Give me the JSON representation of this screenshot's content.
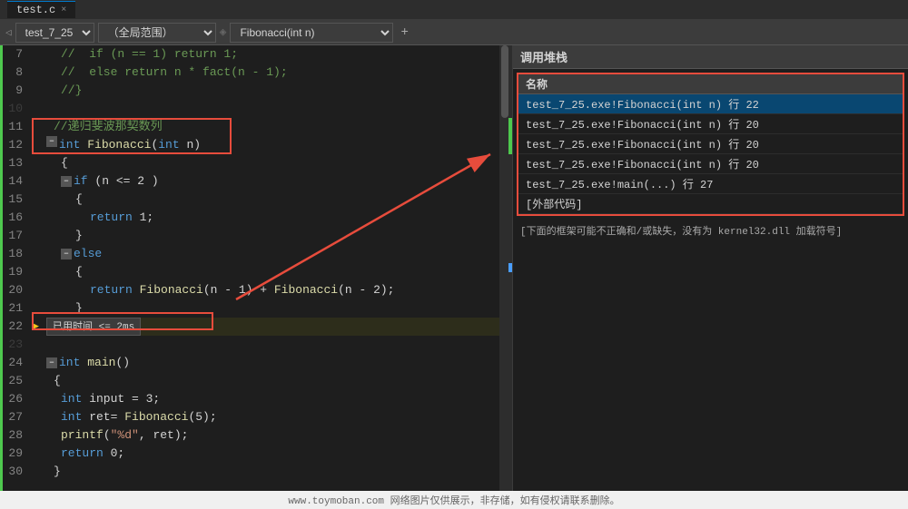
{
  "title_bar": {
    "tab_label": "test.c",
    "close_label": "×"
  },
  "toolbar": {
    "file_name": "test_7_25",
    "scope_dropdown": "（全局范围）",
    "function_dropdown": "Fibonacci(int n)"
  },
  "code": {
    "lines": [
      {
        "num": 7,
        "indent": 2,
        "content": "//  if (n == 1) return 1;",
        "type": "comment"
      },
      {
        "num": 8,
        "indent": 2,
        "content": "//  else return n * fact(n - 1);",
        "type": "comment"
      },
      {
        "num": 9,
        "indent": 2,
        "content": "//}",
        "type": "comment"
      },
      {
        "num": 10,
        "indent": 0,
        "content": "",
        "type": "empty"
      },
      {
        "num": 11,
        "indent": 1,
        "content": "//递归斐波那契数列",
        "type": "comment"
      },
      {
        "num": 12,
        "indent": 0,
        "content": "int Fibonacci(int n)",
        "type": "code",
        "has_fold": true
      },
      {
        "num": 13,
        "indent": 1,
        "content": "{",
        "type": "code"
      },
      {
        "num": 14,
        "indent": 2,
        "content": "if (n <= 2 )",
        "type": "code",
        "has_fold": true
      },
      {
        "num": 15,
        "indent": 2,
        "content": "{",
        "type": "code"
      },
      {
        "num": 16,
        "indent": 3,
        "content": "return 1;",
        "type": "code"
      },
      {
        "num": 17,
        "indent": 2,
        "content": "}",
        "type": "code"
      },
      {
        "num": 18,
        "indent": 2,
        "content": "else",
        "type": "code",
        "has_fold": true
      },
      {
        "num": 19,
        "indent": 2,
        "content": "{",
        "type": "code"
      },
      {
        "num": 20,
        "indent": 3,
        "content": "return Fibonacci(n - 1) + Fibonacci(n - 2);",
        "type": "code"
      },
      {
        "num": 21,
        "indent": 2,
        "content": "}",
        "type": "code"
      },
      {
        "num": 22,
        "indent": 0,
        "content": "",
        "type": "current",
        "tooltip": "已用时间 <= 2ms"
      },
      {
        "num": 23,
        "indent": 0,
        "content": "",
        "type": "empty"
      },
      {
        "num": 24,
        "indent": 0,
        "content": "int main()",
        "type": "code",
        "has_fold": true
      },
      {
        "num": 25,
        "indent": 1,
        "content": "{",
        "type": "code"
      },
      {
        "num": 26,
        "indent": 2,
        "content": "int input = 3;",
        "type": "code"
      },
      {
        "num": 27,
        "indent": 2,
        "content": "int ret= Fibonacci(5);",
        "type": "code"
      },
      {
        "num": 28,
        "indent": 2,
        "content": "printf(\"%d\", ret);",
        "type": "code"
      },
      {
        "num": 29,
        "indent": 2,
        "content": "return 0;",
        "type": "code"
      },
      {
        "num": 30,
        "indent": 1,
        "content": "}",
        "type": "code"
      }
    ]
  },
  "call_stack": {
    "panel_title": "调用堆栈",
    "column_header": "名称",
    "entries": [
      {
        "label": "test_7_25.exe!Fibonacci(int n) 行 22",
        "selected": true
      },
      {
        "label": "test_7_25.exe!Fibonacci(int n) 行 20",
        "selected": false
      },
      {
        "label": "test_7_25.exe!Fibonacci(int n) 行 20",
        "selected": false
      },
      {
        "label": "test_7_25.exe!Fibonacci(int n) 行 20",
        "selected": false
      },
      {
        "label": "test_7_25.exe!main(...) 行 27",
        "selected": false
      },
      {
        "label": "[外部代码]",
        "selected": false
      }
    ],
    "warning": "[下面的框架可能不正确和/或缺失，没有为 kernel32.dll 加载符号]"
  },
  "watermark": "www.toymoban.com 网络图片仅供展示，非存储，如有侵权请联系删除。",
  "colors": {
    "accent": "#007acc",
    "red_border": "#e74c3c",
    "green": "#4ec94e",
    "arrow": "#e74c3c",
    "selected_row": "#094771"
  }
}
